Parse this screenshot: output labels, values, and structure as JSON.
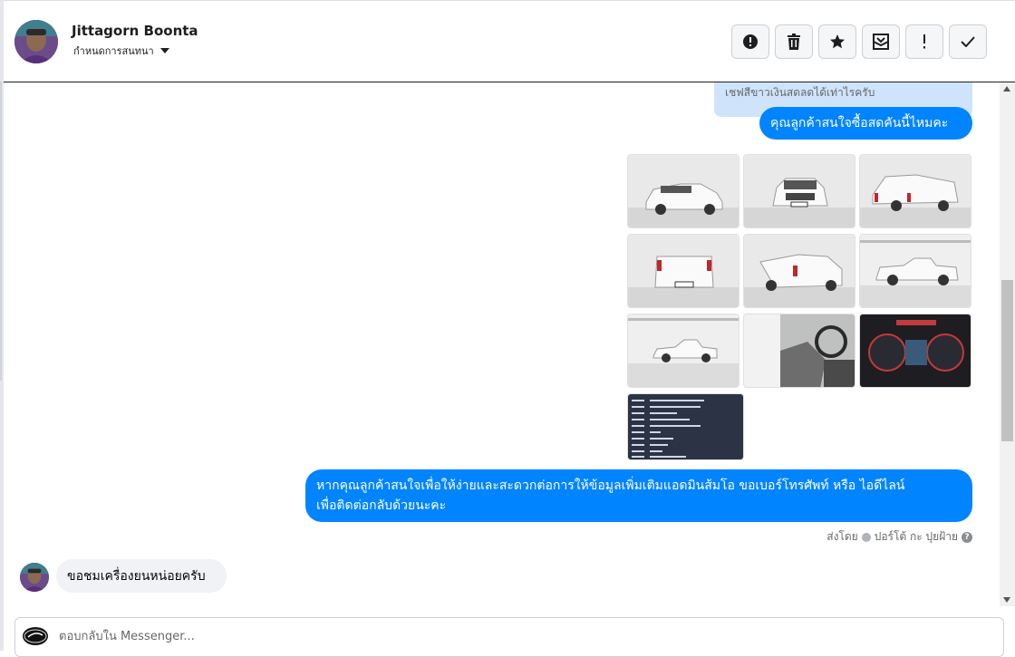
{
  "header": {
    "contact_name": "Jittagorn Boonta",
    "conversation_setting": "กำหนดการสนทนา",
    "toolbar": [
      {
        "name": "report-spam-button",
        "icon": "alert-circle-icon"
      },
      {
        "name": "delete-button",
        "icon": "trash-icon"
      },
      {
        "name": "star-button",
        "icon": "star-icon"
      },
      {
        "name": "mark-unread-button",
        "icon": "envelope-icon"
      },
      {
        "name": "mark-important-button",
        "icon": "exclamation-icon"
      },
      {
        "name": "mark-done-button",
        "icon": "check-icon"
      }
    ]
  },
  "thread": {
    "quoted_reply": "เชฟสีขาวเงินสดลดได้เท่าไรครับ",
    "outgoing_1": "คุณลูกค้าสนใจซื้อสดคันนี้ไหมคะ",
    "photos": [
      {
        "subject": "car-front-left"
      },
      {
        "subject": "car-front"
      },
      {
        "subject": "car-rear-right"
      },
      {
        "subject": "car-rear"
      },
      {
        "subject": "car-rear-left"
      },
      {
        "subject": "car-side"
      },
      {
        "subject": "car-side-far"
      },
      {
        "subject": "car-interior"
      },
      {
        "subject": "car-gauge-cluster"
      },
      {
        "subject": "car-spec-sheet"
      }
    ],
    "outgoing_2_line1": "หากคุณลูกค้าสนใจเพื่อให้ง่ายและสะดวกต่อการให้ข้อมูลเพิ่มเติมแอดมินส้มโอ ขอเบอร์โทรศัพท์ หรือ ไอดีไลน์",
    "outgoing_2_line2": "เพื่อติดต่อกลับด้วยนะคะ",
    "sent_by_label": "ส่งโดย",
    "sent_by_name": "ปอร์โต้ กะ ปุยฝ้าย",
    "incoming_1": "ขอชมเครื่องยนหน่อยครับ"
  },
  "composer": {
    "placeholder": "ตอบกลับใน Messenger..."
  },
  "colors": {
    "outgoing_bubble": "#0084ff",
    "incoming_bubble": "#f0f2f5",
    "quoted_bubble": "#cfe4fb"
  }
}
